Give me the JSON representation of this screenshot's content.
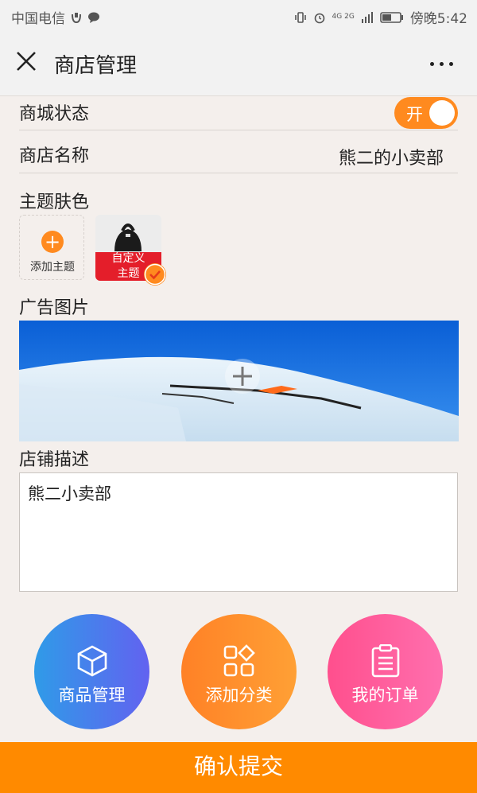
{
  "status_bar": {
    "carrier": "中国电信",
    "network": "4G 2G",
    "time": "傍晚5:42"
  },
  "nav": {
    "title": "商店管理"
  },
  "form": {
    "mall_status": {
      "label": "商城状态",
      "toggle_text": "开"
    },
    "shop_name": {
      "label": "商店名称",
      "value": "熊二的小卖部"
    },
    "theme": {
      "label": "主题肤色",
      "add_label": "添加主题",
      "custom_label_line1": "自定义",
      "custom_label_line2": "主题"
    },
    "ad_image": {
      "label": "广告图片"
    },
    "description": {
      "label": "店铺描述",
      "value": "熊二小卖部"
    }
  },
  "actions": [
    {
      "label": "商品管理",
      "icon": "box-icon"
    },
    {
      "label": "添加分类",
      "icon": "grid-icon"
    },
    {
      "label": "我的订单",
      "icon": "clipboard-icon"
    }
  ],
  "submit": {
    "label": "确认提交"
  },
  "colors": {
    "accent": "#ff8a1f",
    "submit": "#ff8a00",
    "theme_red": "#e41e2a"
  }
}
